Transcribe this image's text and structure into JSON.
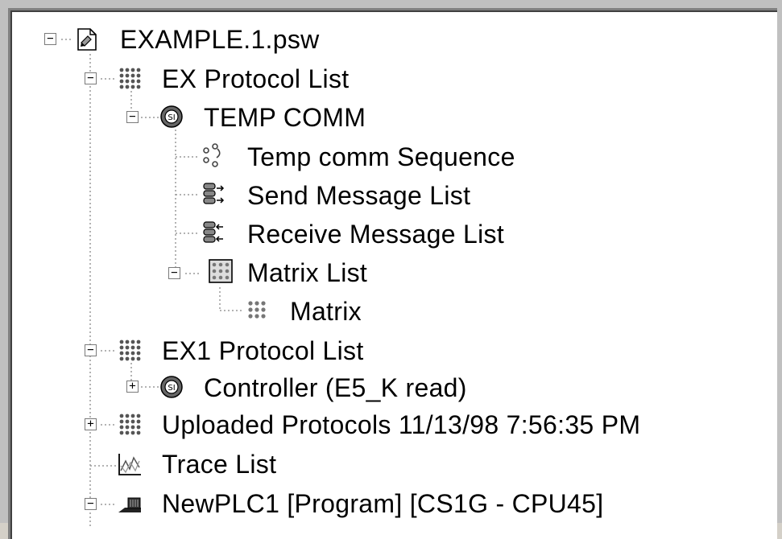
{
  "tree": {
    "root": {
      "label": "EXAMPLE.1.psw",
      "icon": "project-file-icon",
      "expander": "−"
    },
    "ex_protocol_list": {
      "label": "EX Protocol List",
      "icon": "protocol-list-icon",
      "expander": "−"
    },
    "temp_comm": {
      "label": "TEMP COMM",
      "icon": "protocol-icon",
      "expander": "−"
    },
    "sequence": {
      "label": "Temp comm  Sequence",
      "icon": "sequence-icon"
    },
    "send_list": {
      "label": "Send Message List",
      "icon": "send-message-icon"
    },
    "receive_list": {
      "label": "Receive Message List",
      "icon": "receive-message-icon"
    },
    "matrix_list": {
      "label": "Matrix List",
      "icon": "matrix-list-icon",
      "expander": "−"
    },
    "matrix": {
      "label": "Matrix",
      "icon": "matrix-icon"
    },
    "ex1_protocol_list": {
      "label": "EX1 Protocol List",
      "icon": "protocol-list-icon",
      "expander": "−"
    },
    "controller": {
      "label": "Controller (E5_K read)",
      "icon": "protocol-icon",
      "expander": "+"
    },
    "uploaded": {
      "label": "Uploaded Protocols 11/13/98 7:56:35 PM",
      "icon": "protocol-list-icon",
      "expander": "+"
    },
    "trace_list": {
      "label": "Trace List",
      "icon": "trace-list-icon"
    },
    "newplc": {
      "label": "NewPLC1 [Program] [CS1G - CPU45]",
      "icon": "plc-icon",
      "expander": "−"
    }
  }
}
